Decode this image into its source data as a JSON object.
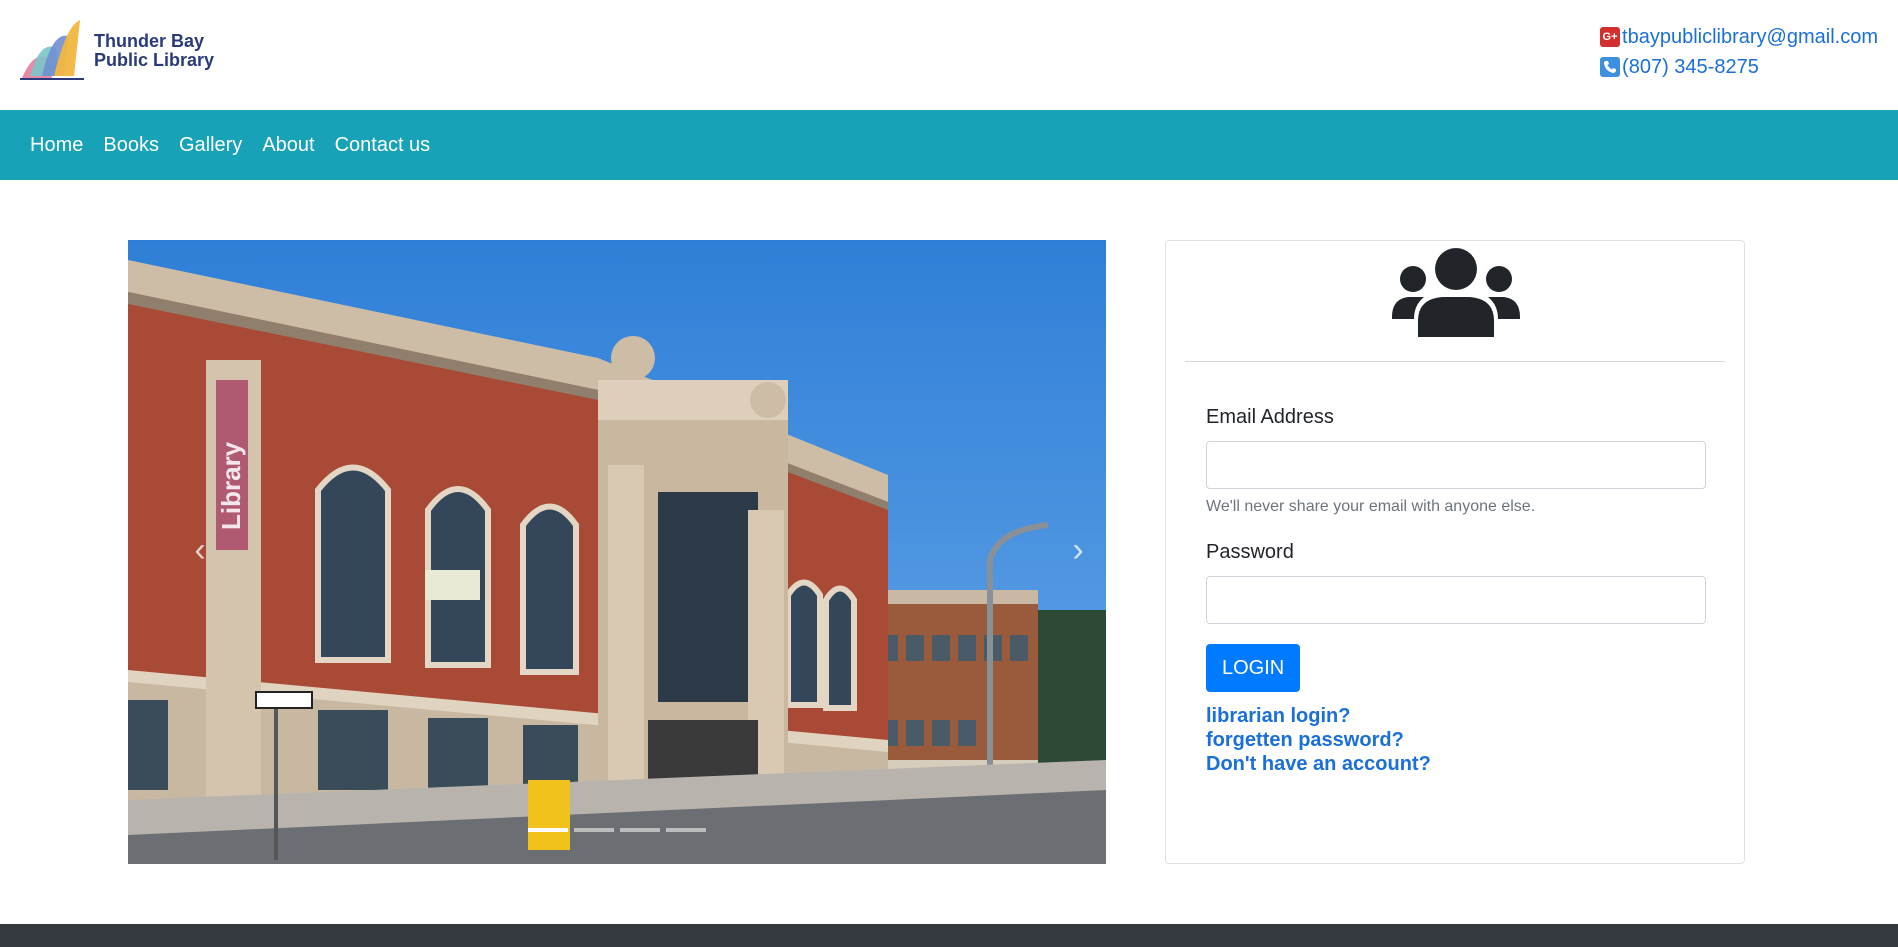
{
  "header": {
    "logo": {
      "line1": "Thunder Bay",
      "line2": "Public Library"
    },
    "email": "tbaypubliclibrary@gmail.com",
    "phone": "(807) 345-8275",
    "gplus_icon": "G+"
  },
  "nav": {
    "items": [
      {
        "label": "Home"
      },
      {
        "label": "Books"
      },
      {
        "label": "Gallery"
      },
      {
        "label": "About"
      },
      {
        "label": "Contact us"
      }
    ]
  },
  "carousel": {
    "prev_icon": "‹",
    "next_icon": "›",
    "indicator_count": 4,
    "active_index": 0,
    "image_sign_text": "Library"
  },
  "login": {
    "email_label": "Email Address",
    "email_value": "",
    "email_help": "We'll never share your email with anyone else.",
    "password_label": "Password",
    "password_value": "",
    "button_label": "LOGIN",
    "links": {
      "librarian": "librarian login?",
      "forgot": "forgetten password?",
      "signup": "Don't have an account?"
    }
  },
  "colors": {
    "navbar": "#17a2b8",
    "primary": "#007bff",
    "link": "#1a6fd8",
    "footer": "#343a40"
  }
}
